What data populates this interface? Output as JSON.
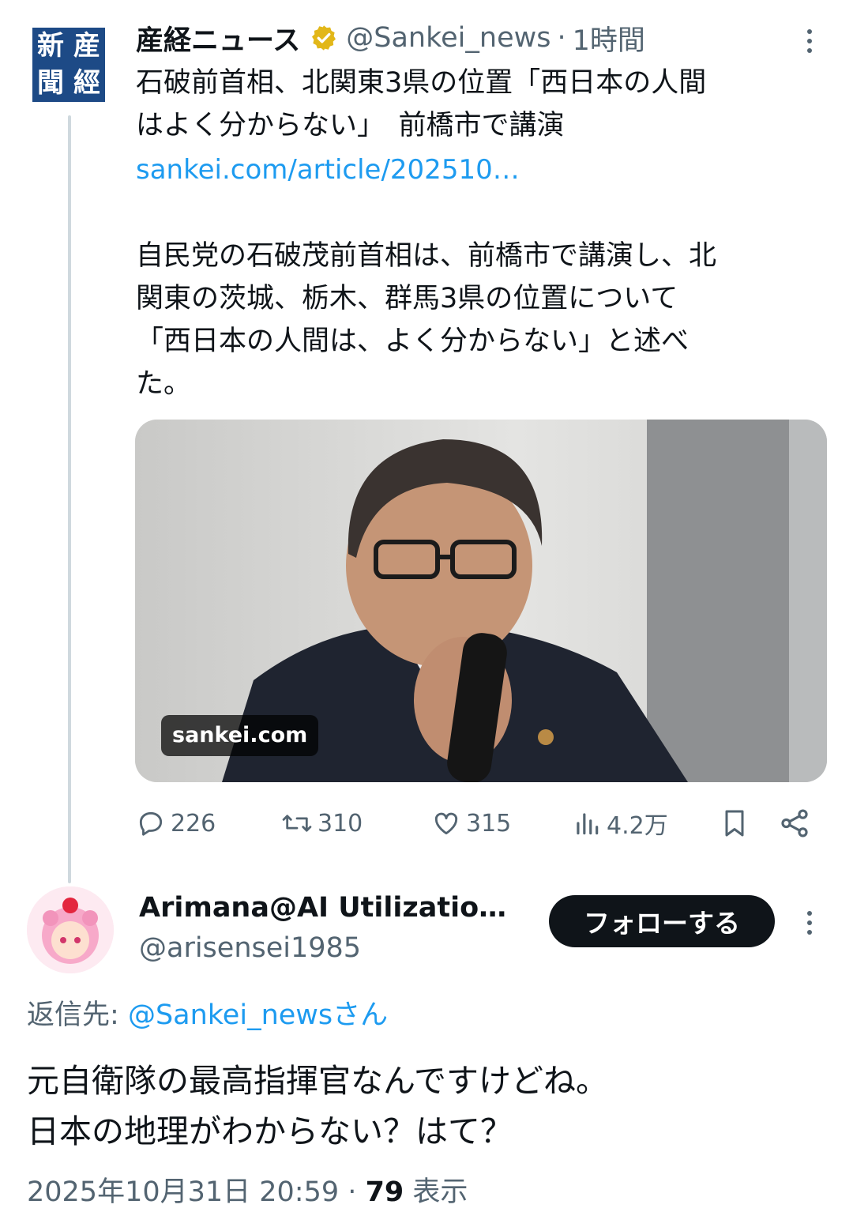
{
  "tweet": {
    "logo_chars": [
      "新",
      "産",
      "聞",
      "經"
    ],
    "author_name": "産経ニュース",
    "author_handle": "@Sankei_news",
    "separator": "·",
    "time": "1時間",
    "headline": "石破前首相、北関東3県の位置「西日本の人間\nはよく分からない」　前橋市で講演",
    "link": "sankei.com/article/202510…",
    "body": "自民党の石破茂前首相は、前橋市で講演し、北\n関東の茨城、栃木、群馬3県の位置について\n「西日本の人間は、よく分からない」と述べ\nた。",
    "media_domain": "sankei.com",
    "actions": {
      "replies": "226",
      "retweets": "310",
      "likes": "315",
      "views": "4.2万"
    },
    "colors": {
      "link": "#1d9bf0",
      "verified": "#e2b719",
      "secondary_text": "#536471"
    }
  },
  "reply": {
    "name": "Arimana@AI Utilizatio…",
    "handle": "@arisensei1985",
    "follow_label": "フォローする",
    "replying_label": "返信先:",
    "replying_handle": "@Sankei_newsさん",
    "text": "元自衛隊の最高指揮官なんですけどね。\n日本の地理がわからない？はて？",
    "date": "2025年10月31日 20:59",
    "separator": "·",
    "view_count": "79",
    "view_label": "表示"
  }
}
